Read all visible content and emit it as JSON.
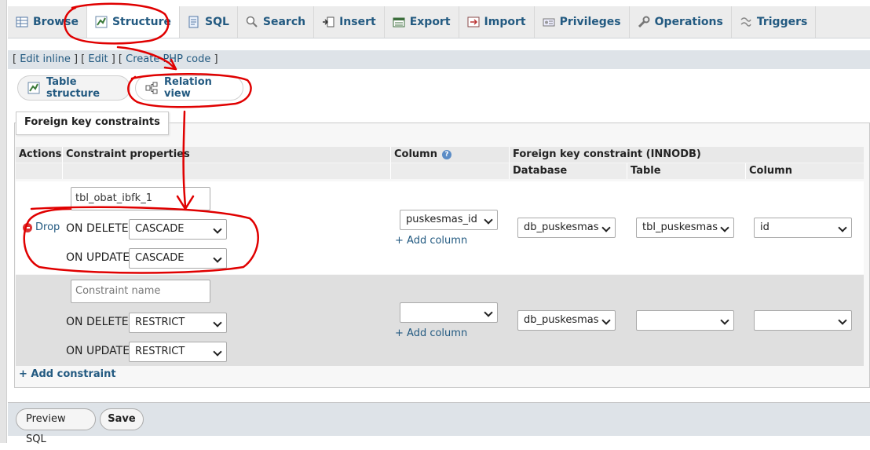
{
  "tabs": [
    {
      "label": "Browse",
      "icon": "browse-icon"
    },
    {
      "label": "Structure",
      "icon": "structure-icon",
      "active": true
    },
    {
      "label": "SQL",
      "icon": "sql-icon"
    },
    {
      "label": "Search",
      "icon": "search-icon"
    },
    {
      "label": "Insert",
      "icon": "insert-icon"
    },
    {
      "label": "Export",
      "icon": "export-icon"
    },
    {
      "label": "Import",
      "icon": "import-icon"
    },
    {
      "label": "Privileges",
      "icon": "privileges-icon"
    },
    {
      "label": "Operations",
      "icon": "operations-icon"
    },
    {
      "label": "Triggers",
      "icon": "triggers-icon"
    }
  ],
  "subbar": {
    "edit_inline": "Edit inline",
    "edit": "Edit",
    "create_php": "Create PHP code"
  },
  "subtabs": {
    "table_structure": "Table structure",
    "relation_view": "Relation view"
  },
  "legend": "Foreign key constraints",
  "headers": {
    "actions": "Actions",
    "constraint_properties": "Constraint properties",
    "column": "Column",
    "fk_constraint": "Foreign key constraint (INNODB)",
    "database": "Database",
    "table": "Table",
    "ref_column": "Column"
  },
  "rows": [
    {
      "drop_label": "Drop",
      "constraint_name": "tbl_obat_ibfk_1",
      "on_delete_label": "ON DELETE",
      "on_delete": "CASCADE",
      "on_update_label": "ON UPDATE",
      "on_update": "CASCADE",
      "column": "puskesmas_id",
      "add_column": "+ Add column",
      "database": "db_puskesmas",
      "table": "tbl_puskesmas",
      "ref_column": "id"
    },
    {
      "constraint_placeholder": "Constraint name",
      "on_delete_label": "ON DELETE",
      "on_delete": "RESTRICT",
      "on_update_label": "ON UPDATE",
      "on_update": "RESTRICT",
      "column": "",
      "add_column": "+ Add column",
      "database": "db_puskesmas",
      "table": "",
      "ref_column": ""
    }
  ],
  "add_constraint": "+ Add constraint",
  "buttons": {
    "preview_sql": "Preview SQL",
    "save": "Save"
  },
  "annotation_color": "#e00000"
}
